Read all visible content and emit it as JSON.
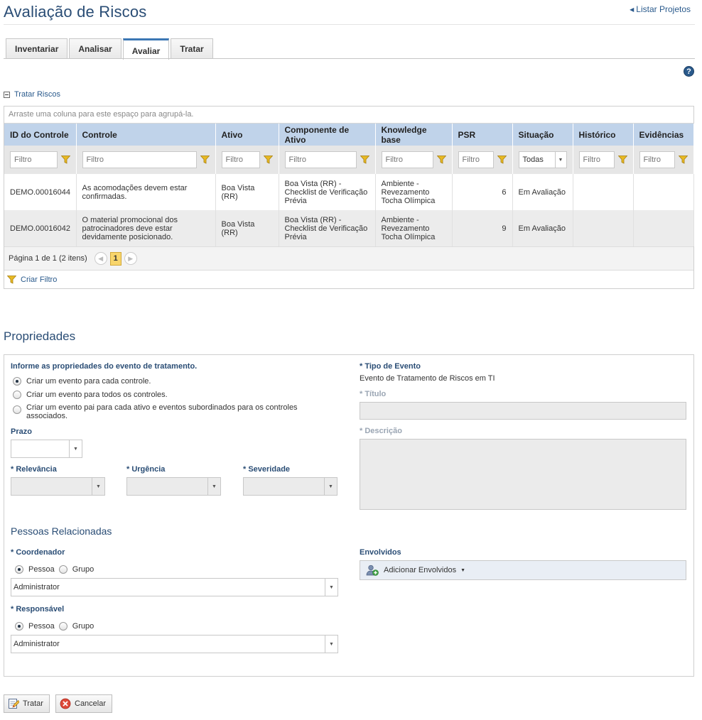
{
  "header": {
    "title": "Avaliação de Riscos",
    "list_link": "Listar Projetos"
  },
  "tabs": [
    {
      "label": "Inventariar"
    },
    {
      "label": "Analisar"
    },
    {
      "label": "Avaliar",
      "active": true
    },
    {
      "label": "Tratar"
    }
  ],
  "section": {
    "toggle_label": "Tratar Riscos"
  },
  "grid": {
    "group_hint": "Arraste uma coluna para este espaço para agrupá-la.",
    "columns": [
      "ID do Controle",
      "Controle",
      "Ativo",
      "Componente de Ativo",
      "Knowledge base",
      "PSR",
      "Situação",
      "Histórico",
      "Evidências"
    ],
    "filter_placeholder": "Filtro",
    "situacao_filter": "Todas",
    "rows": [
      {
        "id": "DEMO.00016044",
        "controle": "As acomodações devem estar confirmadas.",
        "ativo": "Boa Vista (RR)",
        "componente": "Boa Vista (RR) - Checklist de Verificação Prévia",
        "kb": "Ambiente - Revezamento Tocha Olímpica",
        "psr": "6",
        "situacao": "Em Avaliação",
        "historico": "",
        "evidencias": ""
      },
      {
        "id": "DEMO.00016042",
        "controle": "O material promocional dos patrocinadores deve estar devidamente posicionado.",
        "ativo": "Boa Vista (RR)",
        "componente": "Boa Vista (RR) - Checklist de Verificação Prévia",
        "kb": "Ambiente - Revezamento Tocha Olímpica",
        "psr": "9",
        "situacao": "Em Avaliação",
        "historico": "",
        "evidencias": ""
      }
    ],
    "pager_text": "Página 1 de 1 (2 itens)",
    "current_page": "1",
    "create_filter": "Criar Filtro"
  },
  "properties": {
    "title": "Propriedades",
    "intro": "Informe as propriedades do evento de tratamento.",
    "options": [
      {
        "label": "Criar um evento para cada controle.",
        "checked": true
      },
      {
        "label": "Criar um evento para todos os controles.",
        "checked": false
      },
      {
        "label": "Criar um evento pai para cada ativo e eventos subordinados para os controles associados.",
        "checked": false
      }
    ],
    "prazo_label": "Prazo",
    "relevancia_label": "* Relevância",
    "urgencia_label": "* Urgência",
    "severidade_label": "* Severidade",
    "tipo_label": "* Tipo de Evento",
    "tipo_value": "Evento de Tratamento de Riscos em TI",
    "titulo_label": "* Título",
    "descricao_label": "* Descrição",
    "pessoas_title": "Pessoas Relacionadas",
    "coordenador_label": "* Coordenador",
    "responsavel_label": "* Responsável",
    "pessoa_label": "Pessoa",
    "grupo_label": "Grupo",
    "coordenador_value": "Administrator",
    "responsavel_value": "Administrator",
    "envolvidos_label": "Envolvidos",
    "adicionar_label": "Adicionar Envolvidos"
  },
  "actions": {
    "tratar": "Tratar",
    "cancelar": "Cancelar"
  },
  "colors": {
    "title": "#2a4d75",
    "link": "#2a5a8c",
    "grid_header": "#c0d3ea",
    "tab_accent": "#3c77b4",
    "funnel": "#e8b923"
  }
}
